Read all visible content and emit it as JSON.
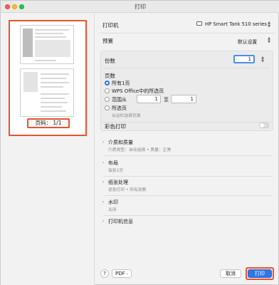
{
  "window": {
    "title": "打印"
  },
  "preview": {
    "page_label": "页码：  1/1"
  },
  "printer": {
    "label": "打印机",
    "value": "HP Smart Tank 510 series"
  },
  "presets": {
    "label": "预置",
    "value": "默认设置"
  },
  "copies": {
    "label": "份数",
    "value": "1"
  },
  "pages": {
    "label": "页数",
    "options": [
      {
        "label": "所有1页",
        "selected": true
      },
      {
        "label": "WPS Office中的所选页",
        "selected": false
      },
      {
        "label": "范围从",
        "selected": false
      },
      {
        "label": "所选页",
        "selected": false
      }
    ],
    "range_from": "1",
    "range_to_label": "至",
    "range_to": "1",
    "selection_hint": "从边栏选择页面"
  },
  "color": {
    "label": "彩色打印",
    "enabled": false
  },
  "sections": [
    {
      "title": "介质和质量",
      "subtitle": "介质类型：自动选择 • 质量：正常"
    },
    {
      "title": "布局",
      "subtitle": "每张1页"
    },
    {
      "title": "纸张处理",
      "subtitle": "逐张打印 • 所有张数"
    },
    {
      "title": "水印",
      "subtitle": "关闭"
    },
    {
      "title": "打印机信息",
      "subtitle": ""
    }
  ],
  "footer": {
    "help": "?",
    "pdf": "PDF",
    "cancel": "取消",
    "print": "打印"
  },
  "colors": {
    "accent": "#2f76e8",
    "highlight": "#e8522f"
  }
}
